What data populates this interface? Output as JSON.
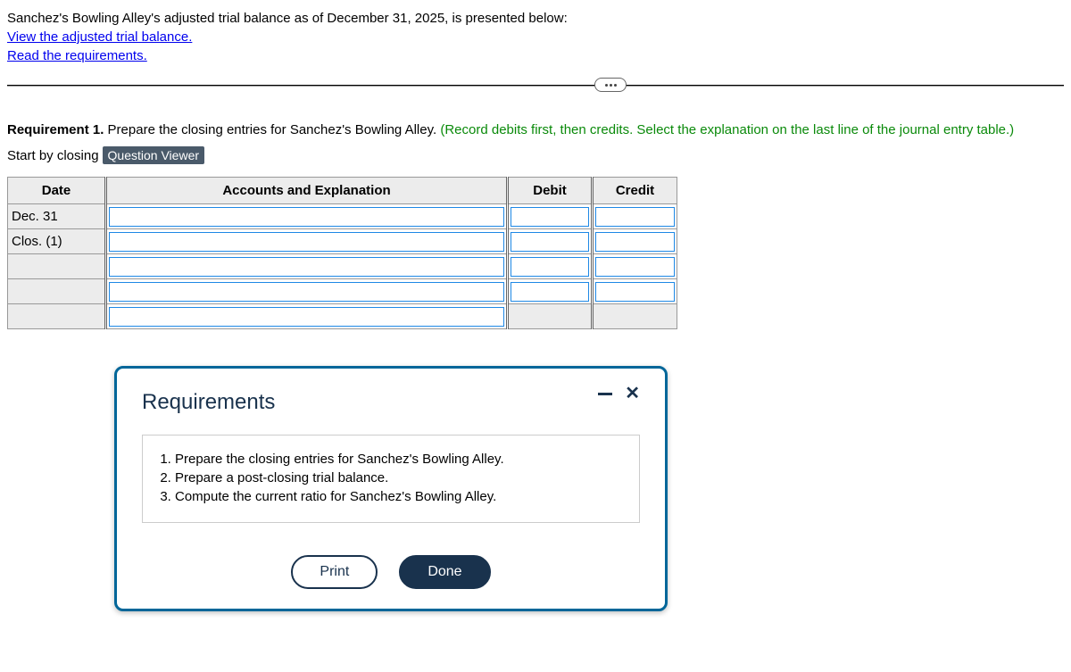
{
  "intro": "Sanchez's Bowling Alley's adjusted trial balance as of December 31, 2025, is presented below:",
  "links": {
    "view_atb": "View the adjusted trial balance.",
    "read_req": "Read the requirements."
  },
  "requirement1": {
    "label": "Requirement 1.",
    "text_plain": " Prepare the closing entries for Sanchez's Bowling Alley. ",
    "text_green": "(Record debits first, then credits. Select the explanation on the last line of the journal entry table.)"
  },
  "start_line": {
    "prefix": "Start by closing",
    "badge": "Question Viewer"
  },
  "table": {
    "headers": {
      "date": "Date",
      "accounts": "Accounts and Explanation",
      "debit": "Debit",
      "credit": "Credit"
    },
    "date_lines": {
      "l1": "Dec. 31",
      "l2": "Clos. (1)"
    }
  },
  "modal": {
    "title": "Requirements",
    "items": [
      "Prepare the closing entries for Sanchez's Bowling Alley.",
      "Prepare a post-closing trial balance.",
      "Compute the current ratio for Sanchez's Bowling Alley."
    ],
    "print": "Print",
    "done": "Done"
  }
}
